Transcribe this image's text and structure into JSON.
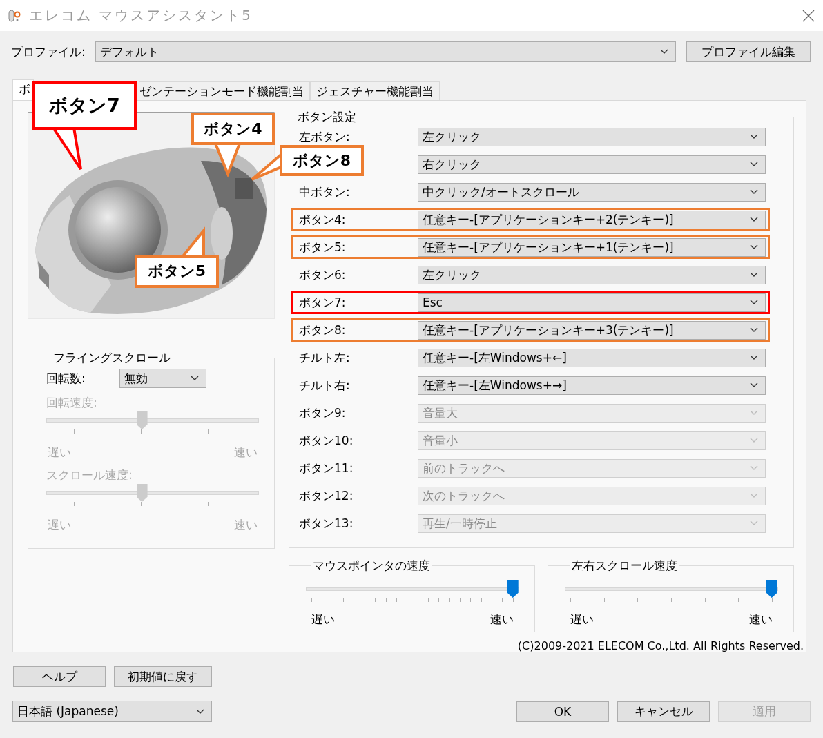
{
  "window": {
    "title": "エレコム マウスアシスタント5"
  },
  "profile": {
    "label": "プロファイル:",
    "value": "デフォルト",
    "edit_button": "プロファイル編集"
  },
  "tabs": [
    {
      "label": "ボ",
      "selected": true
    },
    {
      "label": "ゼンテーションモード機能割当",
      "selected": false
    },
    {
      "label": "ジェスチャー機能割当",
      "selected": false
    }
  ],
  "callouts": [
    {
      "text": "ボタン7",
      "color": "#ff0000"
    },
    {
      "text": "ボタン4",
      "color": "#ed7d31"
    },
    {
      "text": "ボタン8",
      "color": "#ed7d31"
    },
    {
      "text": "ボタン5",
      "color": "#ed7d31"
    }
  ],
  "flying_scroll": {
    "title": "フライングスクロール",
    "rotation_label": "回転数:",
    "rotation_value": "無効",
    "sliders": [
      {
        "label": "回転速度:",
        "level": 0.45,
        "disabled": true,
        "min_label": "遅い",
        "max_label": "速い"
      },
      {
        "label": "スクロール速度:",
        "level": 0.45,
        "disabled": true,
        "min_label": "遅い",
        "max_label": "速い"
      }
    ]
  },
  "button_settings": {
    "title": "ボタン設定",
    "rows": [
      {
        "label": "左ボタン:",
        "value": "左クリック",
        "disabled": false
      },
      {
        "value": "右クリック",
        "disabled": false
      },
      {
        "label": "中ボタン:",
        "value": "中クリック/オートスクロール",
        "disabled": false
      },
      {
        "label": "ボタン4:",
        "value": "任意キー-[アプリケーションキー+2(テンキー)]",
        "disabled": false,
        "color": "#ed7d31"
      },
      {
        "label": "ボタン5:",
        "value": "任意キー-[アプリケーションキー+1(テンキー)]",
        "disabled": false,
        "color": "#ed7d31"
      },
      {
        "label": "ボタン6:",
        "value": "左クリック",
        "disabled": false
      },
      {
        "label": "ボタン7:",
        "value": "Esc",
        "disabled": false,
        "color": "#ff0000"
      },
      {
        "label": "ボタン8:",
        "value": "任意キー-[アプリケーションキー+3(テンキー)]",
        "disabled": false,
        "color": "#ed7d31"
      },
      {
        "label": "チルト左:",
        "value": "任意キー-[左Windows+←]",
        "disabled": false
      },
      {
        "label": "チルト右:",
        "value": "任意キー-[左Windows+→]",
        "disabled": false
      },
      {
        "label": "ボタン9:",
        "value": "音量大",
        "disabled": true
      },
      {
        "label": "ボタン10:",
        "value": "音量小",
        "disabled": true
      },
      {
        "label": "ボタン11:",
        "value": "前のトラックへ",
        "disabled": true
      },
      {
        "label": "ボタン12:",
        "value": "次のトラックへ",
        "disabled": true
      },
      {
        "label": "ボタン13:",
        "value": "再生/一時停止",
        "disabled": true
      }
    ]
  },
  "speed_groups": [
    {
      "title": "マウスポインタの速度",
      "level": 0.97,
      "min_label": "遅い",
      "max_label": "速い"
    },
    {
      "title": "左右スクロール速度",
      "level": 0.97,
      "min_label": "遅い",
      "max_label": "速い"
    }
  ],
  "copyright": "(C)2009-2021 ELECOM Co.,Ltd. All Rights Reserved.",
  "tool_buttons": [
    {
      "label": "ヘルプ"
    },
    {
      "label": "初期値に戻す"
    }
  ],
  "language": "日本語 (Japanese)",
  "dialog_buttons": [
    {
      "label": "OK",
      "disabled": false
    },
    {
      "label": "キャンセル",
      "disabled": false
    },
    {
      "label": "適用",
      "disabled": true
    }
  ]
}
